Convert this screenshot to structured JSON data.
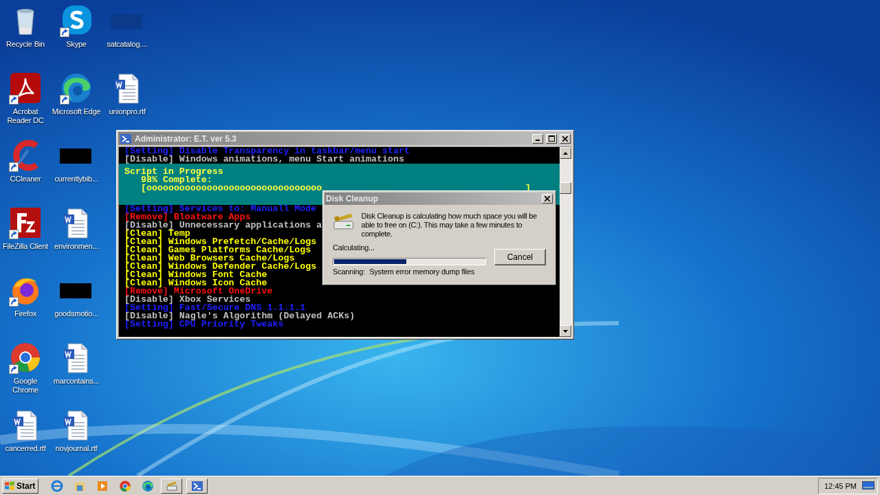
{
  "desktop_icons": [
    {
      "label": "Recycle Bin",
      "kind": "recycle",
      "shortcut": false
    },
    {
      "label": "Acrobat Reader DC",
      "kind": "acrobat",
      "shortcut": true
    },
    {
      "label": "CCleaner",
      "kind": "ccleaner",
      "shortcut": true
    },
    {
      "label": "FileZilla Client",
      "kind": "filezilla",
      "shortcut": true
    },
    {
      "label": "Firefox",
      "kind": "firefox",
      "shortcut": true
    },
    {
      "label": "Google Chrome",
      "kind": "chrome",
      "shortcut": true
    },
    {
      "label": "cancerred.rtf",
      "kind": "document",
      "shortcut": false
    },
    {
      "label": "Skype",
      "kind": "skype",
      "shortcut": true
    },
    {
      "label": "Microsoft Edge",
      "kind": "edge",
      "shortcut": true
    },
    {
      "label": "currentlybib...",
      "kind": "thumbnail",
      "shortcut": false
    },
    {
      "label": "environmen...",
      "kind": "document",
      "shortcut": false
    },
    {
      "label": "goodsmotio...",
      "kind": "thumbnail",
      "shortcut": false
    },
    {
      "label": "marcontains...",
      "kind": "document",
      "shortcut": false
    },
    {
      "label": "novjournal.rtf",
      "kind": "document",
      "shortcut": false
    },
    {
      "label": "satcatalog....",
      "kind": "blank",
      "shortcut": false
    },
    {
      "label": "unionpro.rtf",
      "kind": "document",
      "shortcut": false
    }
  ],
  "console": {
    "title": "Administrator: E.T. ver 5.3",
    "lines_before": [
      {
        "kind": "setting",
        "text": "[Setting] Disable Transparency in taskbar/menu start"
      },
      {
        "kind": "disable",
        "text": "[Disable] Windows animations, menu Start animations"
      }
    ],
    "progress": {
      "title": "Script in Progress",
      "percent": "98% Complete:",
      "bar": "[oooooooooooooooooooooooooooooooo",
      "bar_end": "]"
    },
    "lines_after": [
      {
        "kind": "setting",
        "text": "[Setting] Services to: Manuall Mode"
      },
      {
        "kind": "remove",
        "text": "[Remove] Bloatware Apps"
      },
      {
        "kind": "disable",
        "text": "[Disable] Unnecessary applications a"
      },
      {
        "kind": "clean",
        "text": "[Clean] Temp"
      },
      {
        "kind": "clean",
        "text": "[Clean] Windows Prefetch/Cache/Logs"
      },
      {
        "kind": "clean",
        "text": "[Clean] Games Platforms Cache/Logs"
      },
      {
        "kind": "clean",
        "text": "[Clean] Web Browsers Cache/Logs"
      },
      {
        "kind": "clean",
        "text": "[Clean] Windows Defender Cache/Logs"
      },
      {
        "kind": "clean",
        "text": "[Clean] Windows Font Cache"
      },
      {
        "kind": "clean",
        "text": "[Clean] Windows Icon Cache"
      },
      {
        "kind": "remove",
        "text": "[Remove] Microsoft OneDrive"
      },
      {
        "kind": "disable",
        "text": "[Disable] Xbox Services"
      },
      {
        "kind": "setting",
        "text": "[Setting] Fast/Secure DNS 1.1.1.1"
      },
      {
        "kind": "disable",
        "text": "[Disable] Nagle's Algorithm (Delayed ACKs)"
      },
      {
        "kind": "setting",
        "text": "[Setting] CPU Priority Tweaks"
      }
    ]
  },
  "dialog": {
    "title": "Disk Cleanup",
    "message": "Disk Cleanup is calculating how much space you will be able to free on  (C:). This may take a few minutes to complete.",
    "status": "Calculating...",
    "progress": {
      "level": 0.48
    },
    "cancel": "Cancel",
    "scanning_label": "Scanning:",
    "scanning_item": "System error memory dump files"
  },
  "taskbar": {
    "start": "Start",
    "quick_launch": [
      {
        "kind": "ie"
      },
      {
        "kind": "explorer"
      },
      {
        "kind": "media"
      },
      {
        "kind": "chrome"
      },
      {
        "kind": "edge"
      }
    ],
    "tasks": [
      {
        "kind": "cleanup"
      },
      {
        "kind": "console"
      }
    ],
    "clock": "12:45 PM"
  }
}
